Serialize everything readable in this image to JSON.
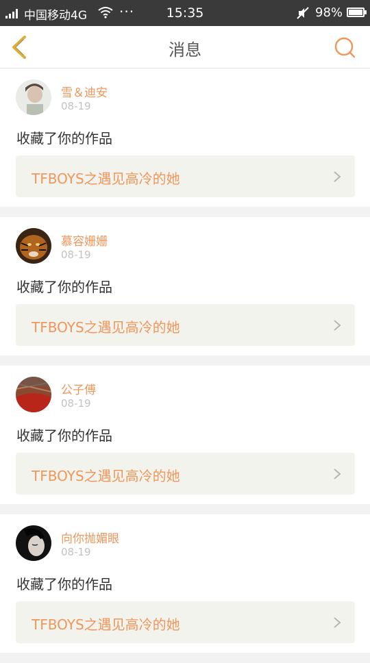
{
  "status_bar": {
    "carrier": "中国移动4G",
    "dots": "···",
    "time": "15:35",
    "battery": "98%"
  },
  "header": {
    "title": "消息",
    "back_icon": "chevron-left-icon",
    "search_icon": "search-icon"
  },
  "colors": {
    "accent": "#f0965a",
    "back_arrow": "#d9b03a",
    "status_bar": "#3a3a3a",
    "card_link_bg": "#f3f3ee"
  },
  "messages": [
    {
      "user": "雪＆迪安",
      "date": "08-19",
      "action": "收藏了你的作品",
      "work_title": "TFBOYS之遇见高冷的她"
    },
    {
      "user": "慕容姗姗",
      "date": "08-19",
      "action": "收藏了你的作品",
      "work_title": "TFBOYS之遇见高冷的她"
    },
    {
      "user": "公子傅",
      "date": "08-19",
      "action": "收藏了你的作品",
      "work_title": "TFBOYS之遇见高冷的她"
    },
    {
      "user": "向你抛媚眼",
      "date": "08-19",
      "action": "收藏了你的作品",
      "work_title": "TFBOYS之遇见高冷的她"
    }
  ]
}
